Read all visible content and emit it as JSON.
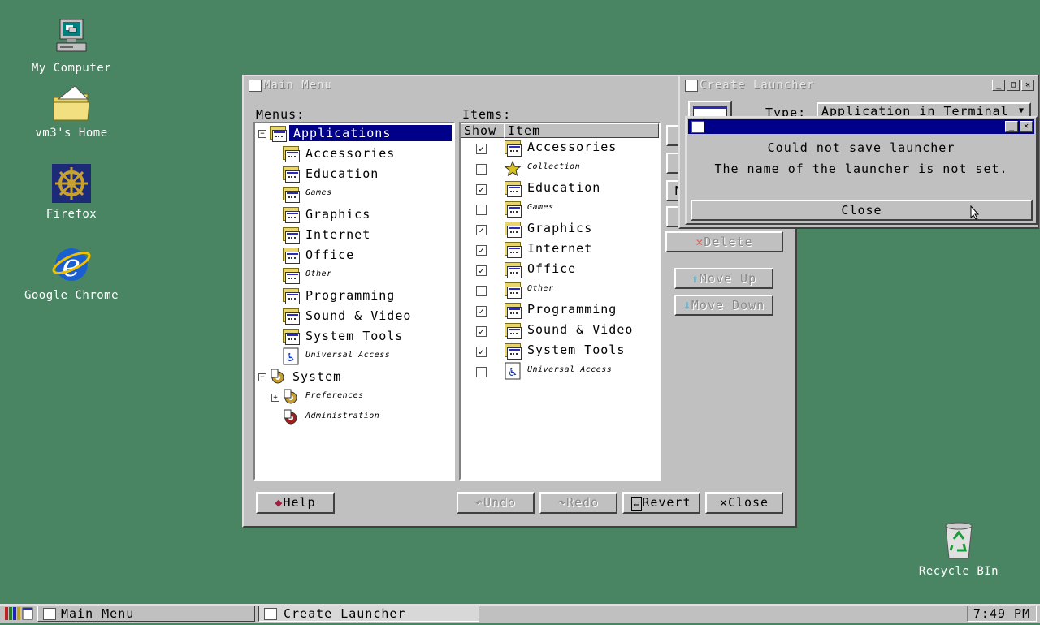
{
  "desktop": {
    "icons": [
      {
        "label": "My Computer",
        "icon": "computer-icon"
      },
      {
        "label": "vm3's Home",
        "icon": "home-folder-icon"
      },
      {
        "label": "Firefox",
        "icon": "firefox-icon"
      },
      {
        "label": "Google Chrome",
        "icon": "chrome-icon"
      },
      {
        "label": "Recycle BIn",
        "icon": "recycle-bin-icon"
      }
    ]
  },
  "main_menu": {
    "title": "Main Menu",
    "menus_label": "Menus:",
    "items_label": "Items:",
    "menus_tree": [
      {
        "label": "Applications",
        "style": "normal",
        "selected": true
      },
      {
        "label": "Accessories",
        "style": "normal"
      },
      {
        "label": "Education",
        "style": "normal"
      },
      {
        "label": "Games",
        "style": "small"
      },
      {
        "label": "Graphics",
        "style": "normal"
      },
      {
        "label": "Internet",
        "style": "normal"
      },
      {
        "label": "Office",
        "style": "normal"
      },
      {
        "label": "Other",
        "style": "small"
      },
      {
        "label": "Programming",
        "style": "normal"
      },
      {
        "label": "Sound & Video",
        "style": "normal"
      },
      {
        "label": "System Tools",
        "style": "normal"
      },
      {
        "label": "Universal Access",
        "style": "small"
      },
      {
        "label": "System",
        "style": "normal"
      },
      {
        "label": "Preferences",
        "style": "small"
      },
      {
        "label": "Administration",
        "style": "small"
      }
    ],
    "items_columns": {
      "show": "Show",
      "item": "Item"
    },
    "items": [
      {
        "label": "Accessories",
        "checked": true,
        "style": "normal"
      },
      {
        "label": "Collection",
        "checked": false,
        "style": "small"
      },
      {
        "label": "Education",
        "checked": true,
        "style": "normal"
      },
      {
        "label": "Games",
        "checked": false,
        "style": "small"
      },
      {
        "label": "Graphics",
        "checked": true,
        "style": "normal"
      },
      {
        "label": "Internet",
        "checked": true,
        "style": "normal"
      },
      {
        "label": "Office",
        "checked": true,
        "style": "normal"
      },
      {
        "label": "Other",
        "checked": false,
        "style": "small"
      },
      {
        "label": "Programming",
        "checked": true,
        "style": "normal"
      },
      {
        "label": "Sound & Video",
        "checked": true,
        "style": "normal"
      },
      {
        "label": "System Tools",
        "checked": true,
        "style": "normal"
      },
      {
        "label": "Universal Access",
        "checked": false,
        "style": "small"
      }
    ],
    "side_buttons": {
      "new_partial": "N",
      "delete": "Delete",
      "move_up": "Move Up",
      "move_down": "Move Down"
    },
    "bottom_buttons": {
      "help": "Help",
      "undo": "Undo",
      "redo": "Redo",
      "revert": "Revert",
      "close": "Close"
    }
  },
  "create_launcher": {
    "title": "Create Launcher",
    "type_label": "Type:",
    "type_value": "Application in Terminal"
  },
  "error_dialog": {
    "line1": "Could not save launcher",
    "line2": "The name of the launcher is not set.",
    "close_label": "Close"
  },
  "taskbar": {
    "tasks": [
      {
        "label": "Main Menu",
        "active": false
      },
      {
        "label": "Create Launcher",
        "active": true
      }
    ],
    "clock": "7:49 PM"
  }
}
